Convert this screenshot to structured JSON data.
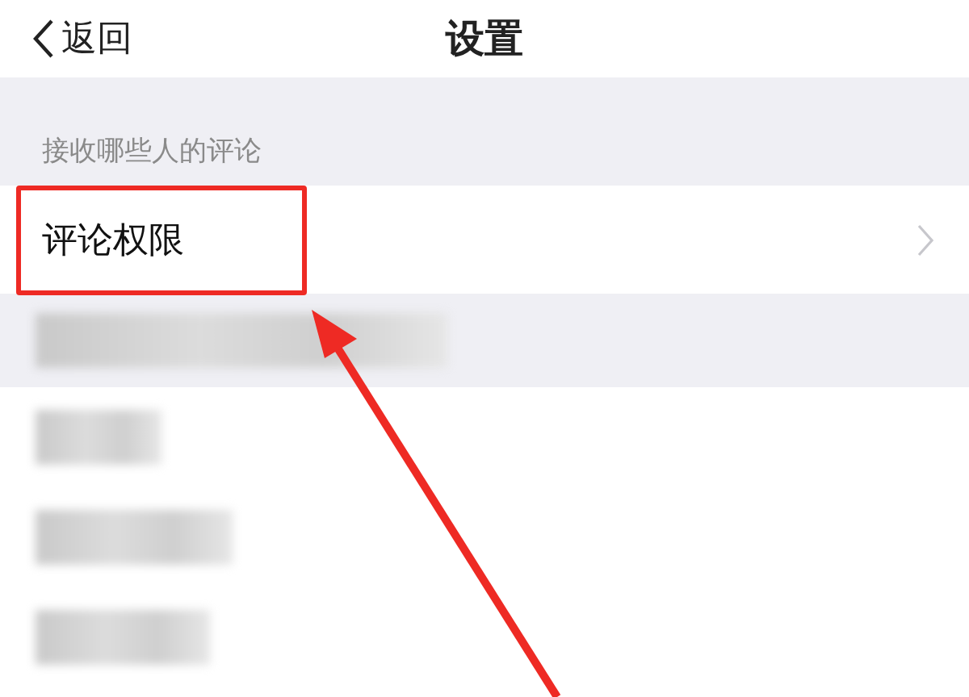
{
  "nav_bar": {
    "back_label": "返回",
    "title": "设置"
  },
  "section": {
    "header": "接收哪些人的评论",
    "items": [
      {
        "label": "评论权限",
        "highlighted": true
      }
    ]
  },
  "blurred_rows": [
    {
      "kind": "gray"
    },
    {
      "kind": "white"
    },
    {
      "kind": "white"
    },
    {
      "kind": "white"
    }
  ],
  "annotation": {
    "arrow": true
  }
}
